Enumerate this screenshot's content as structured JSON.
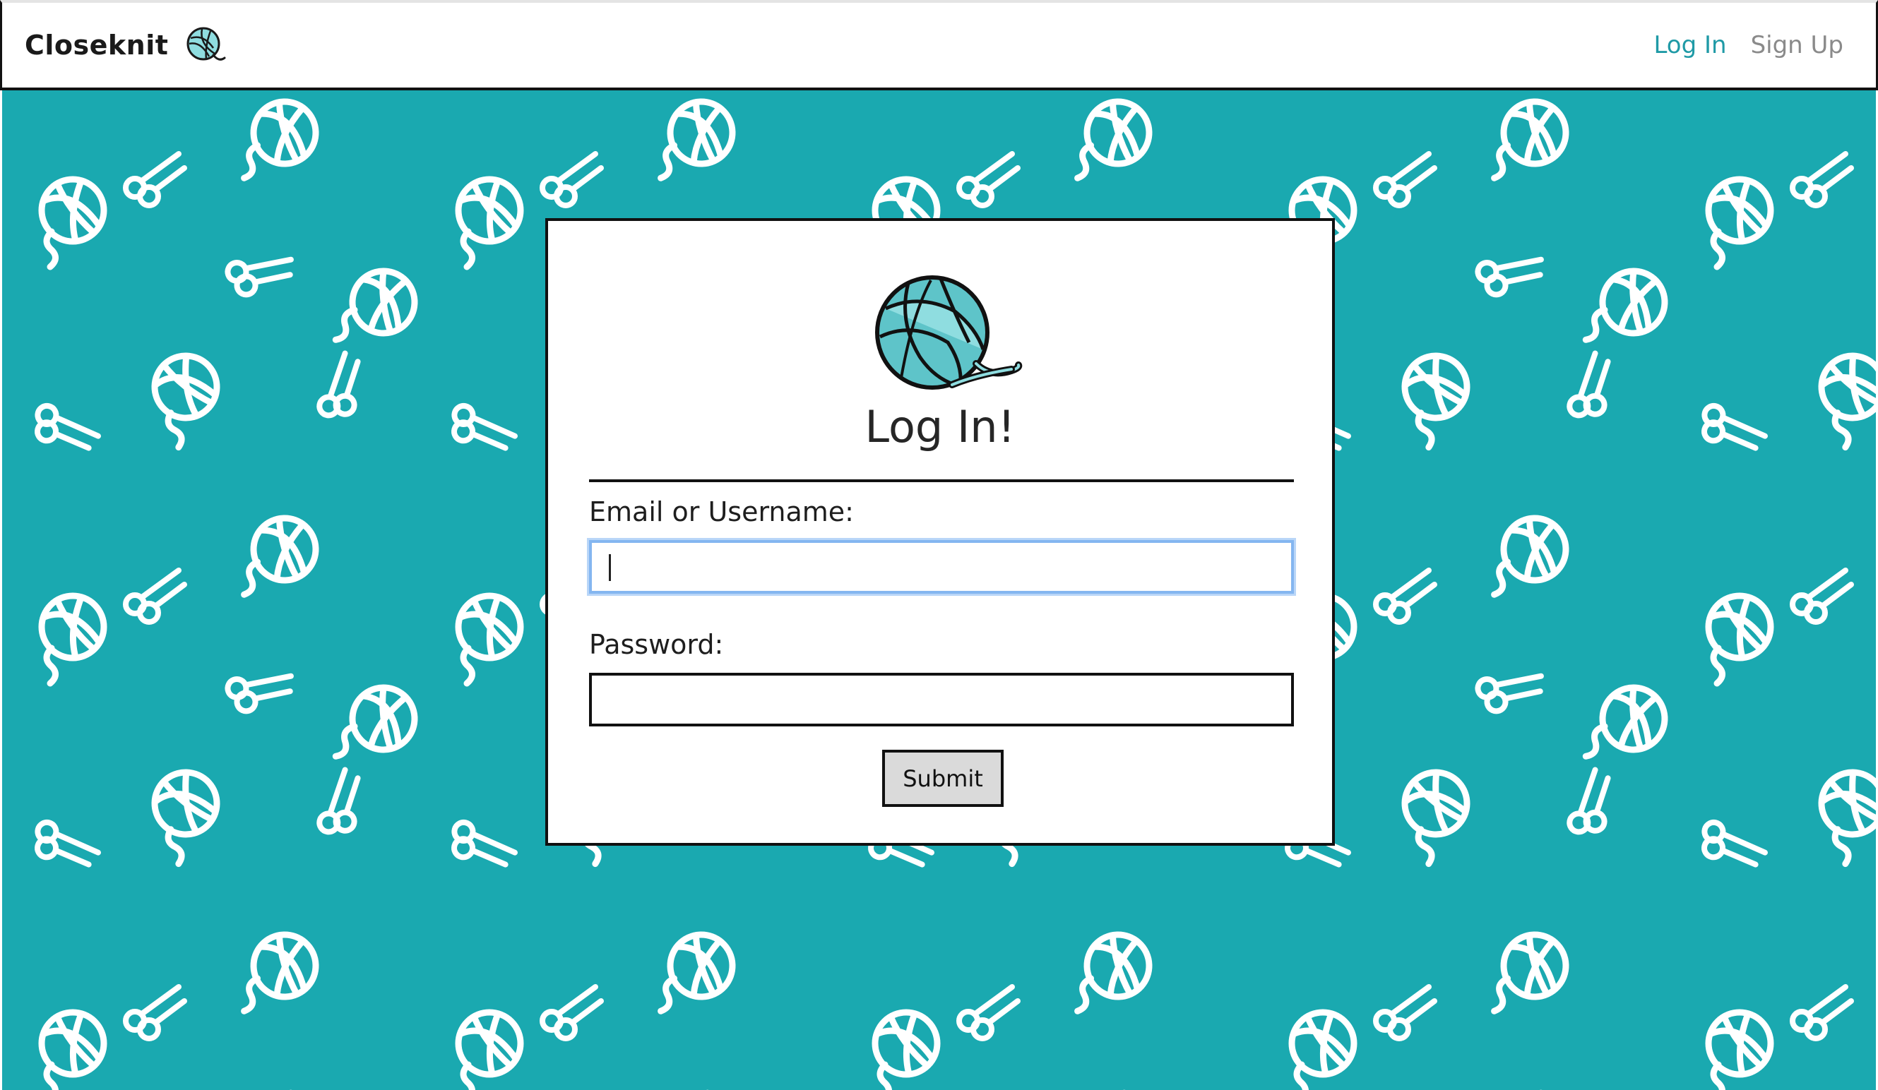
{
  "nav": {
    "brand": "Closeknit",
    "links": {
      "login": "Log In",
      "signup": "Sign Up"
    }
  },
  "login_form": {
    "title": "Log In!",
    "email_label": "Email or Username:",
    "email_value": "",
    "password_label": "Password:",
    "password_value": "",
    "submit_label": "Submit"
  },
  "icons": {
    "brand_logo": "yarn-ball-icon",
    "card_logo": "yarn-ball-icon",
    "pattern": [
      "yarn-ball-icon",
      "scissors-icon"
    ]
  },
  "colors": {
    "accent": "#1f9aa6",
    "background_pattern": "#1aa9b0",
    "focus_ring": "#84b6f0",
    "yarn_light": "#8fdde0",
    "yarn_dark": "#5ec4c9"
  }
}
